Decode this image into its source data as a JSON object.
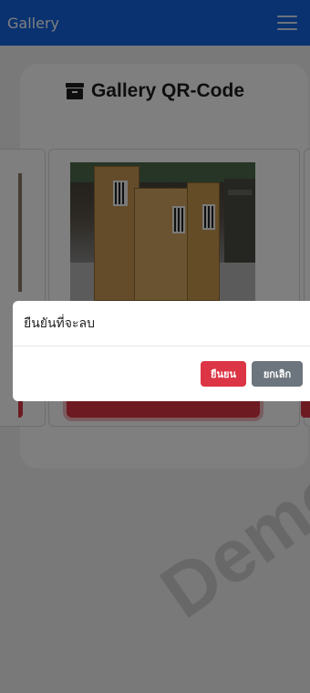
{
  "navbar": {
    "brand": "Gallery",
    "menu_icon": "hamburger-icon",
    "bg_color": "#1565e0"
  },
  "gallery": {
    "title": "Gallery QR-Code",
    "title_icon": "archive-box-icon"
  },
  "modal": {
    "title": "ยืนยันที่จะลบ",
    "confirm_label": "ยืนยน",
    "cancel_label": "ยกเลิก",
    "confirm_color": "#dc3545",
    "cancel_color": "#6c757d"
  },
  "watermark": {
    "text": "Demo"
  }
}
